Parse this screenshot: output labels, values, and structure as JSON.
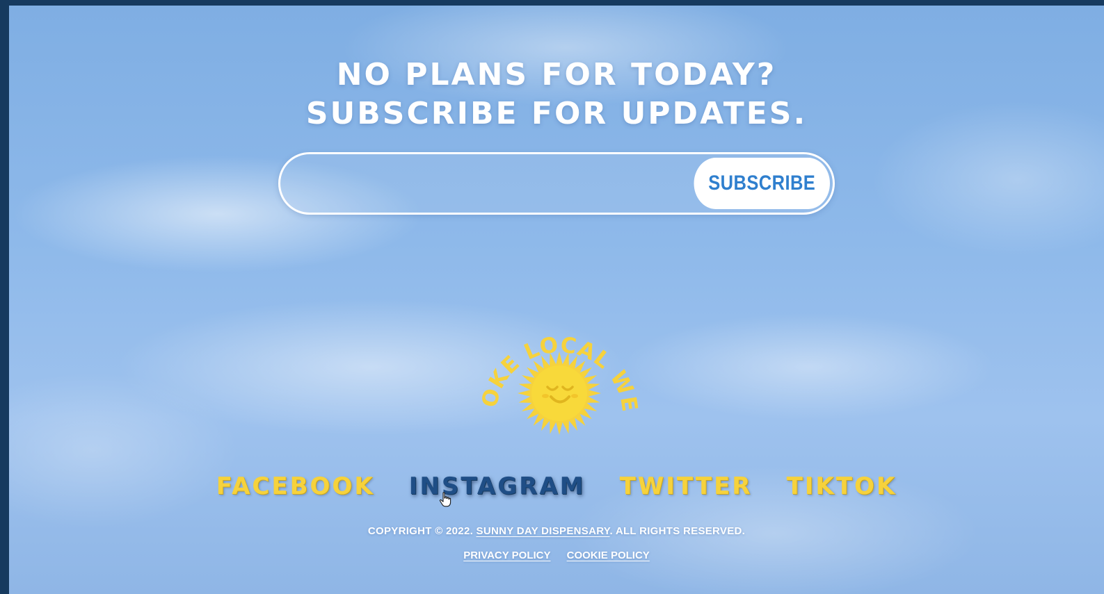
{
  "newsletter": {
    "headline_line1": "NO PLANS FOR TODAY?",
    "headline_line2": "SUBSCRIBE FOR UPDATES.",
    "email_value": "",
    "email_placeholder": "",
    "subscribe_label": "SUBSCRIBE"
  },
  "logo": {
    "arc_text": "SMOKE LOCAL WEED",
    "icon": "smiling-sun-icon",
    "color": "#f6d23c"
  },
  "social": {
    "links": [
      {
        "label": "FACEBOOK",
        "active": false
      },
      {
        "label": "INSTAGRAM",
        "active": true
      },
      {
        "label": "TWITTER",
        "active": false
      },
      {
        "label": "TIKTOK",
        "active": false
      }
    ],
    "link_color": "#f6d23c",
    "active_color": "#1f4e86"
  },
  "footer": {
    "copyright_prefix": "COPYRIGHT © 2022.",
    "brand_name": "SUNNY DAY DISPENSARY",
    "copyright_suffix": ". ALL RIGHTS RESERVED.",
    "privacy_label": "PRIVACY POLICY",
    "cookie_label": "COOKIE POLICY"
  },
  "colors": {
    "frame_border": "#163a5f",
    "sky": "#8eb9ea",
    "button_text": "#2f7fce"
  }
}
